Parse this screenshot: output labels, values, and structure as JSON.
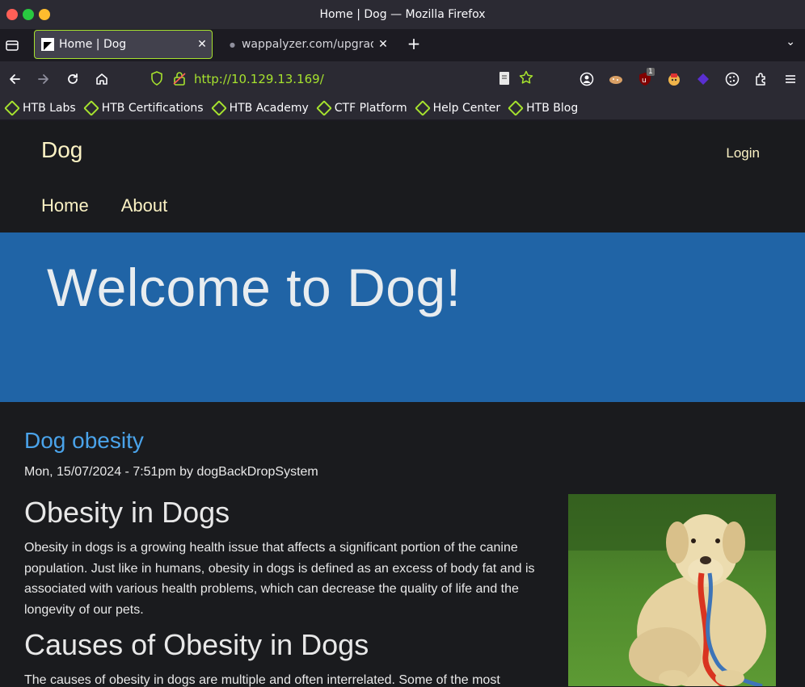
{
  "window": {
    "title": "Home | Dog — Mozilla Firefox"
  },
  "tabs": [
    {
      "label": "Home | Dog",
      "active": true
    },
    {
      "label": "wappalyzer.com/upgrade",
      "active": false
    }
  ],
  "navbar": {
    "url": "http://10.129.13.169/",
    "extension_badge": "1"
  },
  "bookmarks": [
    "HTB Labs",
    "HTB Certifications",
    "HTB Academy",
    "CTF Platform",
    "Help Center",
    "HTB Blog"
  ],
  "site": {
    "name": "Dog",
    "login": "Login",
    "nav": [
      "Home",
      "About"
    ],
    "hero_title": "Welcome to Dog!"
  },
  "article": {
    "title": "Dog obesity",
    "meta": "Mon, 15/07/2024 - 7:51pm by dogBackDropSystem",
    "heading1": "Obesity in Dogs",
    "paragraph1": "Obesity in dogs is a growing health issue that affects a significant portion of the canine population. Just like in humans, obesity in dogs is defined as an excess of body fat and is associated with various health problems, which can decrease the quality of life and the longevity of our pets.",
    "heading2": "Causes of Obesity in Dogs",
    "paragraph2": "The causes of obesity in dogs are multiple and often interrelated. Some of the most"
  },
  "colors": {
    "accent": "#a6e22e",
    "hero": "#2064a6",
    "link": "#4aa3ea",
    "site_text": "#fbf2c4"
  }
}
